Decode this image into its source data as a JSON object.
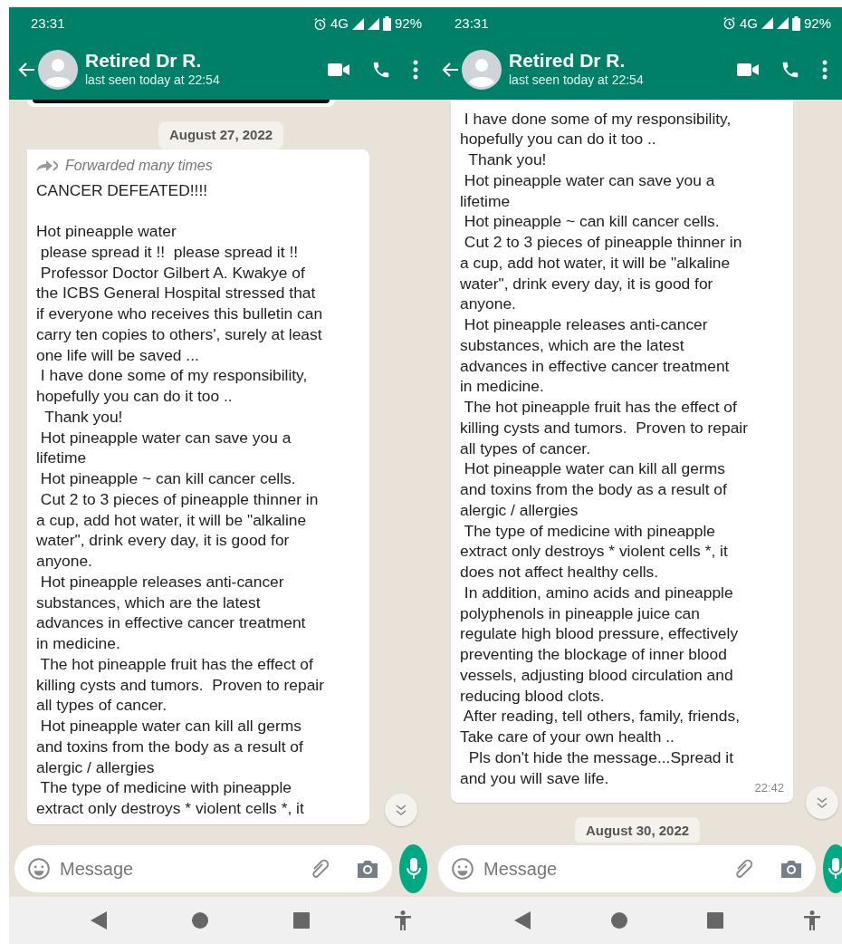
{
  "screens": [
    {
      "status_bar": {
        "time": "23:31",
        "network": "4G",
        "battery": "92%"
      },
      "contact": {
        "name": "Retired Dr R.",
        "last_seen": "last seen today at 22:54"
      },
      "messages": [
        {
          "kind": "media"
        },
        {
          "kind": "date",
          "text": "August 27, 2022"
        },
        {
          "kind": "text",
          "forwarded": "Forwarded many times",
          "paragraphs": [
            [
              "CANCER DEFEATED!!!!"
            ],
            [
              "Hot pineapple water",
              " please spread it !!  please spread it !!",
              " Professor Doctor Gilbert A. Kwakye of",
              "the ICBS General Hospital stressed that",
              "if everyone who receives this bulletin can",
              "carry ten copies to others', surely at least",
              "one life will be saved ...",
              " I have done some of my responsibility,",
              "hopefully you can do it too ..",
              "  Thank you!",
              " Hot pineapple water can save you a",
              "lifetime",
              " Hot pineapple ~ can kill cancer cells.",
              " Cut 2 to 3 pieces of pineapple thinner in",
              "a cup, add hot water, it will be \"alkaline",
              "water\", drink every day, it is good for",
              "anyone.",
              " Hot pineapple releases anti-cancer",
              "substances, which are the latest",
              "advances in effective cancer treatment",
              "in medicine.",
              " The hot pineapple fruit has the effect of",
              "killing cysts and tumors.  Proven to repair",
              "all types of cancer.",
              " Hot pineapple water can kill all germs",
              "and toxins from the body as a result of",
              "alergic / allergies",
              " The type of medicine with pineapple",
              "extract only destroys * violent cells *, it"
            ]
          ]
        }
      ],
      "composer": {
        "placeholder": "Message"
      }
    },
    {
      "status_bar": {
        "time": "23:31",
        "network": "4G",
        "battery": "92%"
      },
      "contact": {
        "name": "Retired Dr R.",
        "last_seen": "last seen today at 22:54"
      },
      "messages": [
        {
          "kind": "text",
          "time": "22:42",
          "paragraphs": [
            [
              " I have done some of my responsibility,",
              "hopefully you can do it too ..",
              "  Thank you!",
              " Hot pineapple water can save you a",
              "lifetime",
              " Hot pineapple ~ can kill cancer cells.",
              " Cut 2 to 3 pieces of pineapple thinner in",
              "a cup, add hot water, it will be \"alkaline",
              "water\", drink every day, it is good for",
              "anyone.",
              " Hot pineapple releases anti-cancer",
              "substances, which are the latest",
              "advances in effective cancer treatment",
              "in medicine.",
              " The hot pineapple fruit has the effect of",
              "killing cysts and tumors.  Proven to repair",
              "all types of cancer.",
              " Hot pineapple water can kill all germs",
              "and toxins from the body as a result of",
              "alergic / allergies",
              " The type of medicine with pineapple",
              "extract only destroys * violent cells *, it",
              "does not affect healthy cells.",
              " In addition, amino acids and pineapple",
              "polyphenols in pineapple juice can",
              "regulate high blood pressure, effectively",
              "preventing the blockage of inner blood",
              "vessels, adjusting blood circulation and",
              "reducing blood clots.",
              " After reading, tell others, family, friends,",
              "Take care of your own health ..",
              "  Pls don't hide the message...Spread it",
              "and you will save life."
            ]
          ]
        },
        {
          "kind": "date",
          "text": "August 30, 2022"
        }
      ],
      "composer": {
        "placeholder": "Message"
      }
    }
  ]
}
